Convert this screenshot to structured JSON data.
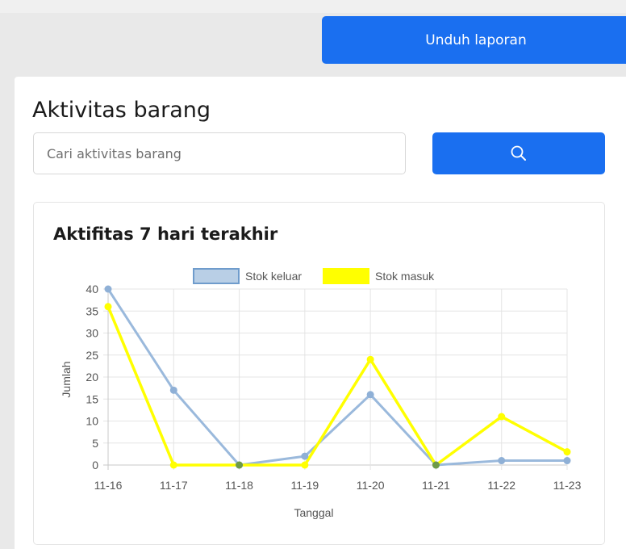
{
  "header": {
    "download_label": "Unduh laporan"
  },
  "panel": {
    "title": "Aktivitas barang"
  },
  "search": {
    "placeholder": "Cari aktivitas barang",
    "icon": "search-icon"
  },
  "colors": {
    "primary": "#1a6ff0",
    "series_out": "#9ab9dc",
    "series_out_fill": "#b9cfe6",
    "series_in": "#ffff00",
    "overlap_point": "#6e9a48"
  },
  "chart_card": {
    "title": "Aktifitas 7 hari terakhir"
  },
  "chart_data": {
    "type": "line",
    "x": [
      "11-16",
      "11-17",
      "11-18",
      "11-19",
      "11-20",
      "11-21",
      "11-22",
      "11-23"
    ],
    "series": [
      {
        "name": "Stok keluar",
        "values": [
          40,
          17,
          0,
          2,
          16,
          0,
          1,
          1
        ],
        "color": "#9ab9dc"
      },
      {
        "name": "Stok masuk",
        "values": [
          36,
          0,
          0,
          0,
          24,
          0,
          11,
          3
        ],
        "color": "#ffff00"
      }
    ],
    "xlabel": "Tanggal",
    "ylabel": "Jumlah",
    "ylim": [
      0,
      40
    ],
    "yticks": [
      0,
      5,
      10,
      15,
      20,
      25,
      30,
      35,
      40
    ],
    "grid": true,
    "legend": "top"
  }
}
